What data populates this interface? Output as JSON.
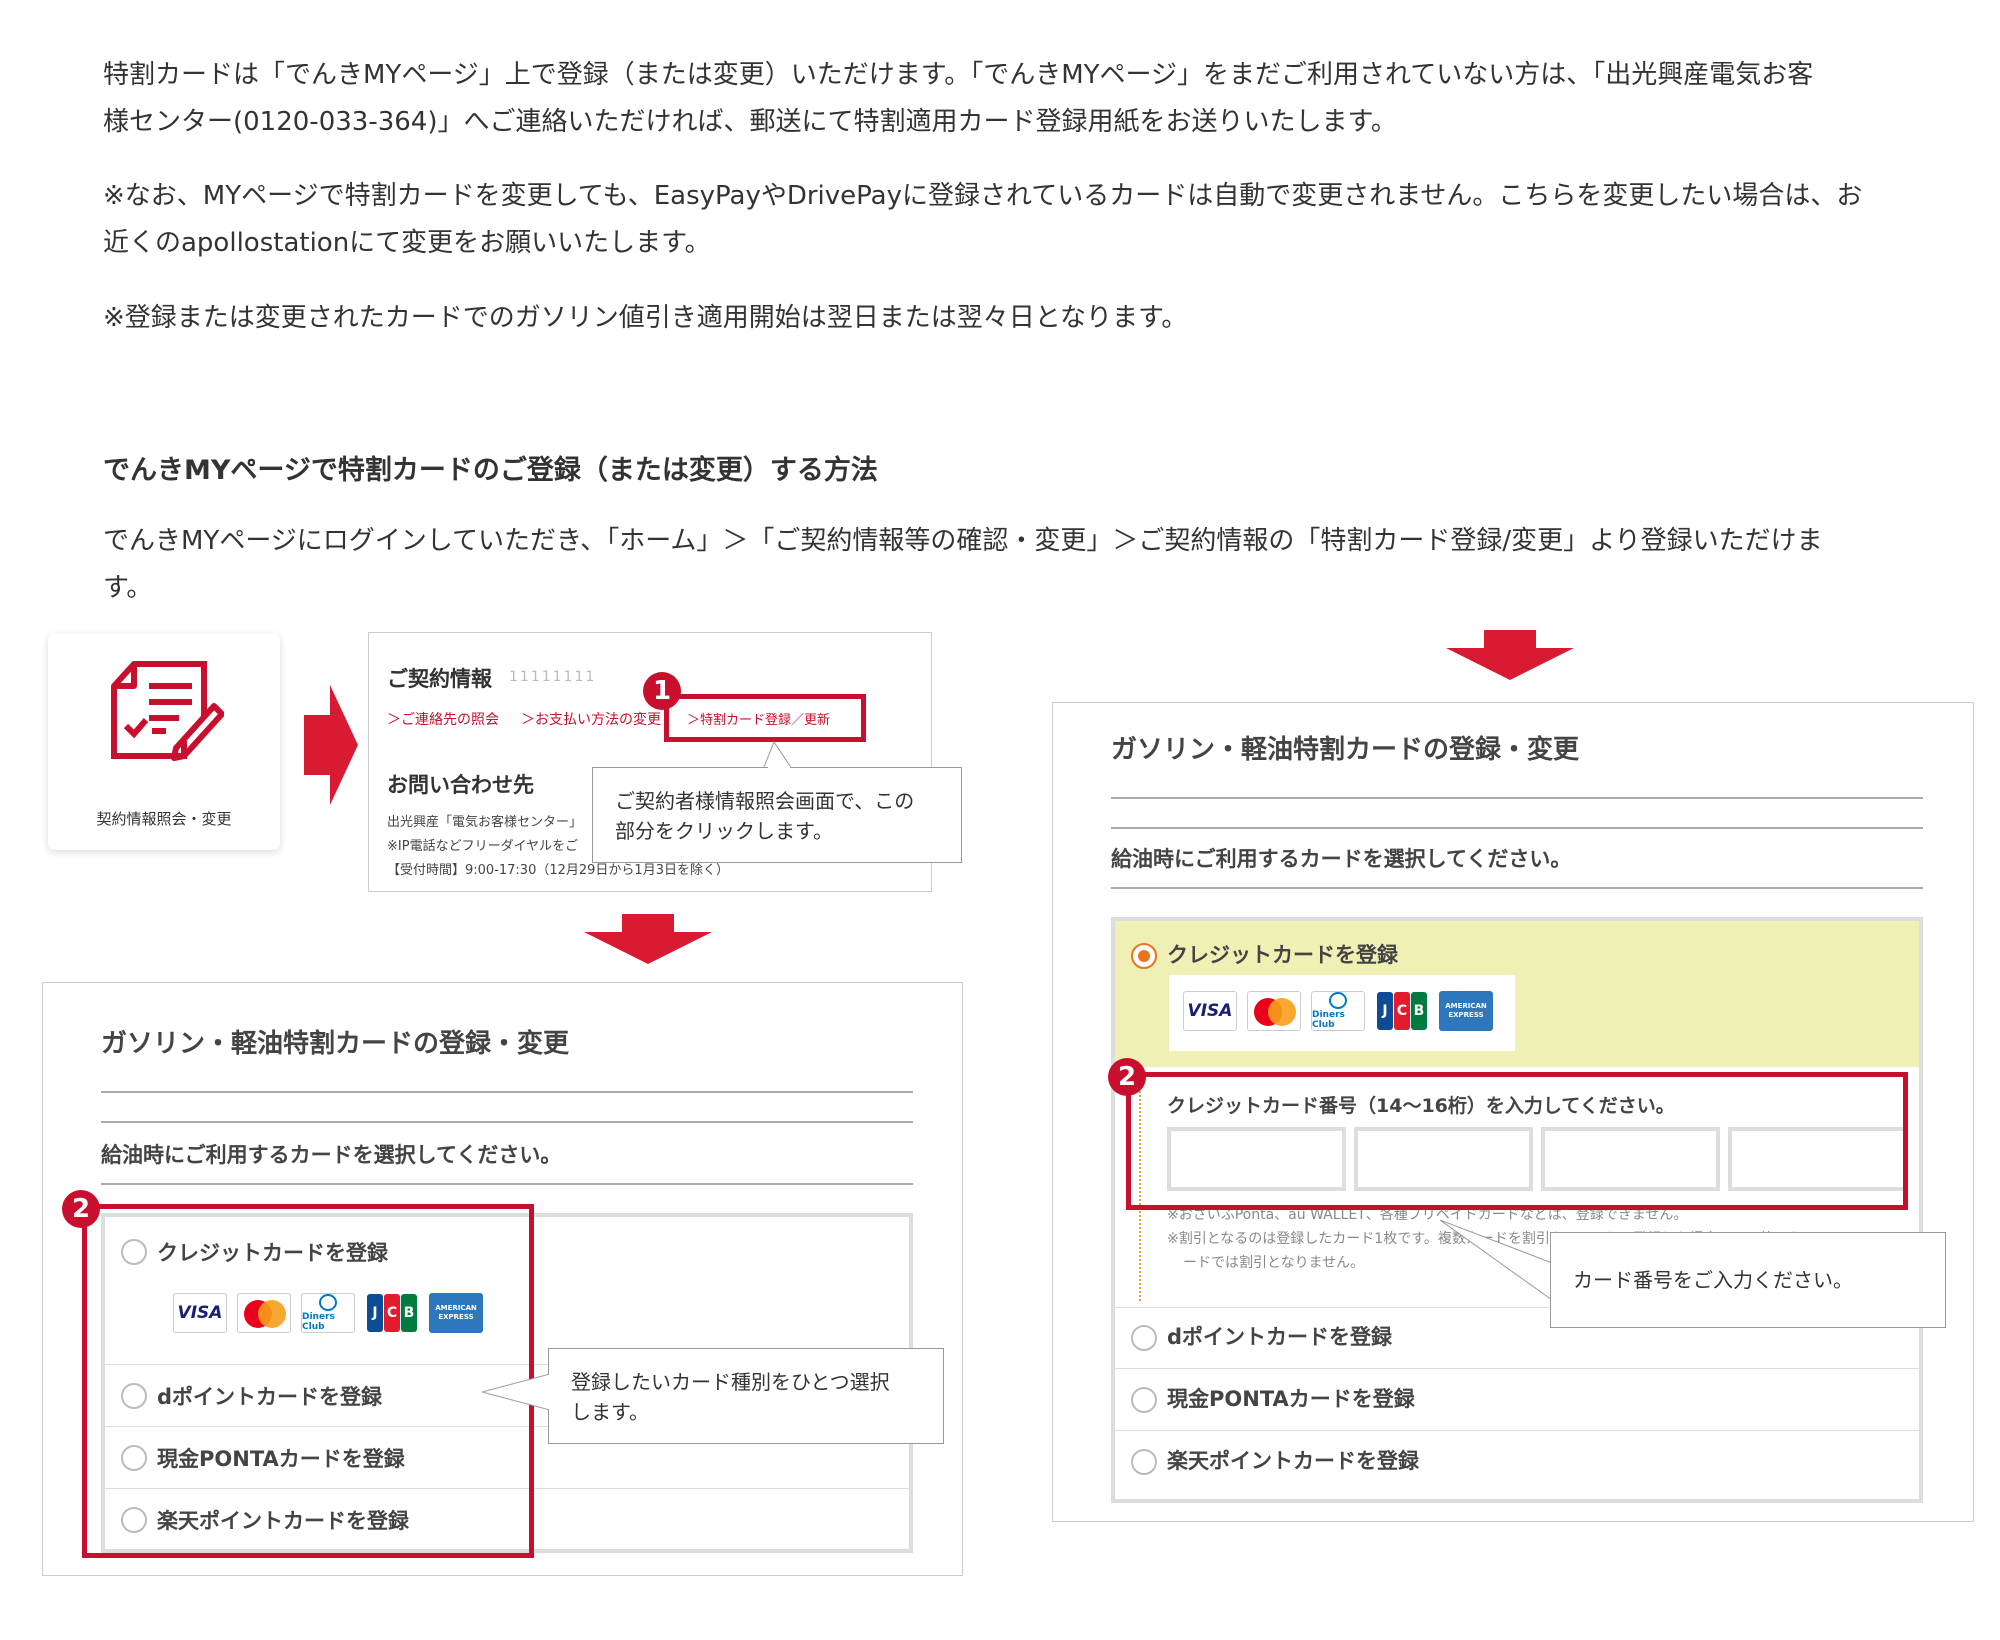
{
  "intro": {
    "p1_line1": "特割カードは「でんきMYページ」上で登録（または変更）いただけます。「でんきMYページ」をまだご利用されていない方は、「出光興産電気お客",
    "p1_line2": "様センター(0120-033-364)」へご連絡いただければ、郵送にて特割適用カード登録用紙をお送りいたします。",
    "p2_line1": "※なお、MYページで特割カードを変更しても、EasyPayやDrivePayに登録されているカードは自動で変更されません。こちらを変更したい場合は、お",
    "p2_line2": "近くのapollostationにて変更をお願いいたします。",
    "p3": "※登録または変更されたカードでのガソリン値引き適用開始は翌日または翌々日となります。"
  },
  "section": {
    "heading": "でんきMYページで特割カードのご登録（または変更）する方法",
    "body_line1": "でんきMYページにログインしていただき、「ホーム」＞「ご契約情報等の確認・変更」＞ご契約情報の「特割カード登録/変更」より登録いただけま",
    "body_line2": "す。"
  },
  "tile": {
    "label": "契約情報照会・変更"
  },
  "contract_panel": {
    "title": "ご契約情報",
    "masked_id": "11111111",
    "link1": "＞ご連絡先の照会",
    "link2": "＞お支払い方法の変更",
    "link3": "＞特割カード登録／更新",
    "inquiry_title": "お問い合わせ先",
    "inquiry_line1": "出光興産「電気お客様センター」",
    "inquiry_line2": "※IP電話などフリーダイヤルをご",
    "inquiry_line3": "【受付時間】9:00-17:30（12月29日から1月3日を除く）"
  },
  "badges": {
    "one": "1",
    "two": "2"
  },
  "callouts": {
    "step1_line1": "ご契約者様情報照会画面で、この",
    "step1_line2": "部分をクリックします。",
    "step2_line1": "登録したいカード種別をひとつ選択",
    "step2_line2": "します。",
    "step3": "カード番号をご入力ください。"
  },
  "form": {
    "title": "ガソリン・軽油特割カードの登録・変更",
    "subtitle": "給油時にご利用するカードを選択してください。",
    "options": [
      "クレジットカードを登録",
      "dポイントカードを登録",
      "現金PONTAカードを登録",
      "楽天ポイントカードを登録"
    ],
    "card_brands": [
      "VISA",
      "Mastercard",
      "Diners Club",
      "JCB",
      "AMERICAN EXPRESS"
    ],
    "cc_number_label": "クレジットカード番号（14〜16桁）を入力してください。",
    "note1": "※おさいふPonta、au WALLET、各種プリペイドカードなどは、登録できません。",
    "note2": "※割引となるのは登録したカード1枚です。複数カードを割引カードとして登録した場合、その他のカ",
    "note3": "ードでは割引となりません。"
  },
  "colors": {
    "accent_red": "#c8102e",
    "selected_bg": "#eef0b4",
    "radio_orange": "#e8761a"
  }
}
